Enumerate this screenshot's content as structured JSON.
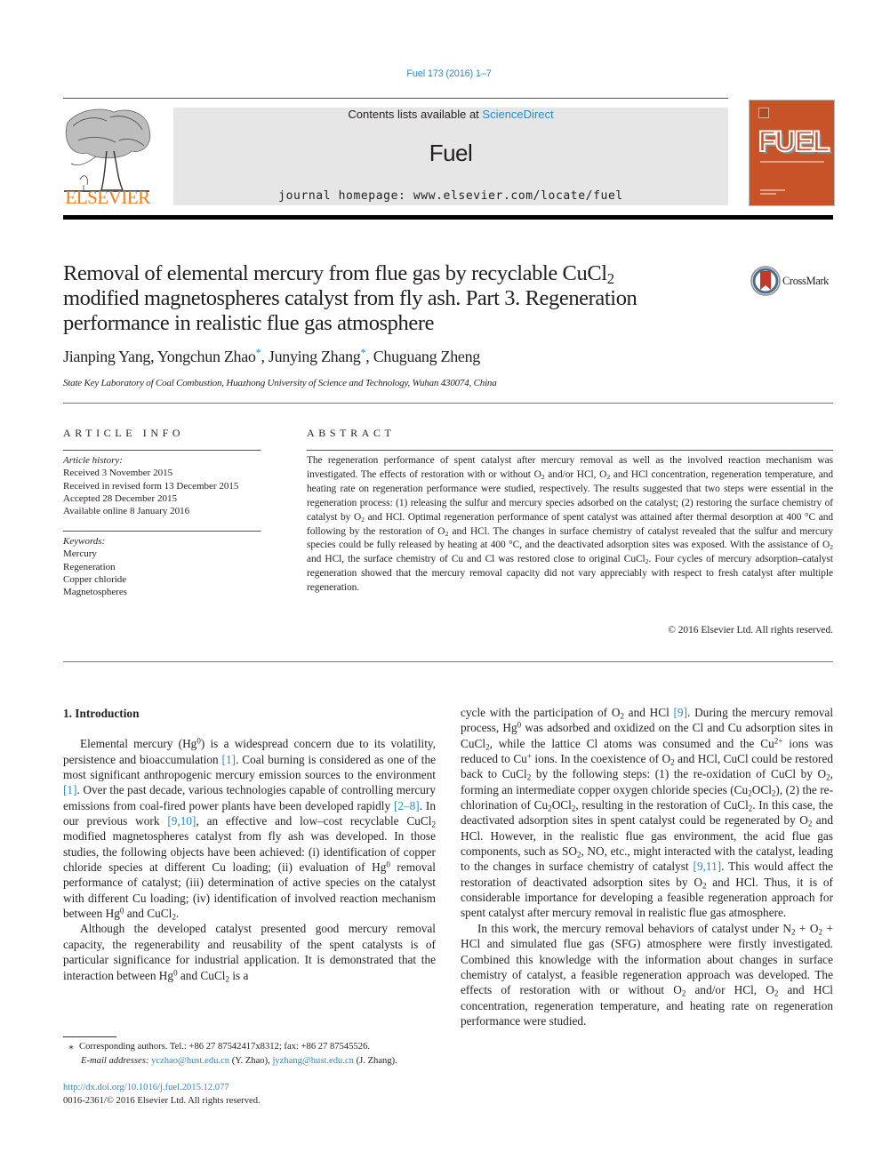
{
  "header": {
    "journal_ref": "Fuel 173 (2016) 1–7",
    "contents_prefix": "Contents lists available at ",
    "contents_link": "ScienceDirect",
    "journal_name": "Fuel",
    "homepage": "journal homepage: www.elsevier.com/locate/fuel",
    "publisher_logo_text": "ELSEVIER",
    "cover_title": "FUEL",
    "brand_colors": {
      "link": "#2a8cc2",
      "elsevier_orange": "#f07c1b",
      "cover": "#c95328",
      "masthead_bg": "#e6e6e6"
    }
  },
  "article": {
    "title_line1_pre": "Removal of elemental mercury from flue gas by recyclable CuCl",
    "title_line1_sub": "2",
    "title_rest": "modified magnetospheres catalyst from fly ash. Part 3. Regeneration performance in realistic flue gas atmosphere",
    "crossmark_label": "CrossMark",
    "authors": [
      {
        "name": "Jianping Yang",
        "corresponding": false
      },
      {
        "name": "Yongchun Zhao",
        "corresponding": true
      },
      {
        "name": "Junying Zhang",
        "corresponding": true
      },
      {
        "name": "Chuguang Zheng",
        "corresponding": false
      }
    ],
    "affiliation": "State Key Laboratory of Coal Combustion, Huazhong University of Science and Technology, Wuhan 430074, China"
  },
  "article_info": {
    "heading": "ARTICLE INFO",
    "history_label": "Article history:",
    "history": [
      "Received 3 November 2015",
      "Received in revised form 13 December 2015",
      "Accepted 28 December 2015",
      "Available online 8 January 2016"
    ],
    "keywords_label": "Keywords:",
    "keywords": [
      "Mercury",
      "Regeneration",
      "Copper chloride",
      "Magnetospheres"
    ]
  },
  "abstract": {
    "heading": "ABSTRACT",
    "text_html": "The regeneration performance of spent catalyst after mercury removal as well as the involved reaction mechanism was investigated. The effects of restoration with or without O<sub>2</sub> and/or HCl, O<sub>2</sub> and HCl concentration, regeneration temperature, and heating rate on regeneration performance were studied, respectively. The results suggested that two steps were essential in the regeneration process: (1) releasing the sulfur and mercury species adsorbed on the catalyst; (2) restoring the surface chemistry of catalyst by O<sub>2</sub> and HCl. Optimal regeneration performance of spent catalyst was attained after thermal desorption at 400 °C and following by the restoration of O<sub>2</sub> and HCl. The changes in surface chemistry of catalyst revealed that the sulfur and mercury species could be fully released by heating at 400 °C, and the deactivated adsorption sites was exposed. With the assistance of O<sub>2</sub> and HCl, the surface chemistry of Cu and Cl was restored close to original CuCl<sub>2</sub>. Four cycles of mercury adsorption–catalyst regeneration showed that the mercury removal capacity did not vary appreciably with respect to fresh catalyst after multiple regeneration.",
    "copyright": "© 2016 Elsevier Ltd. All rights reserved."
  },
  "body": {
    "section_heading": "1. Introduction",
    "left_paragraphs_html": [
      "Elemental mercury (Hg<sup>0</sup>) is a widespread concern due to its volatility, persistence and bioaccumulation <span class=\"link\">[1]</span>. Coal burning is considered as one of the most significant anthropogenic mercury emission sources to the environment <span class=\"link\">[1]</span>. Over the past decade, various technologies capable of controlling mercury emissions from coal-fired power plants have been developed rapidly <span class=\"link\">[2–8]</span>. In our previous work <span class=\"link\">[9,10]</span>, an effective and low–cost recyclable CuCl<sub>2</sub> modified magnetospheres catalyst from fly ash was developed. In those studies, the following objects have been achieved: (i) identification of copper chloride species at different Cu loading; (ii) evaluation of Hg<sup>0</sup> removal performance of catalyst; (iii) determination of active species on the catalyst with different Cu loading; (iv) identification of involved reaction mechanism between Hg<sup>0</sup> and CuCl<sub>2</sub>.",
      "Although the developed catalyst presented good mercury removal capacity, the regenerability and reusability of the spent catalysts is of particular significance for industrial application. It is demonstrated that the interaction between Hg<sup>0</sup> and CuCl<sub>2</sub> is a"
    ],
    "right_paragraphs_html": [
      "cycle with the participation of O<sub>2</sub> and HCl <span class=\"link\">[9]</span>. During the mercury removal process, Hg<sup>0</sup> was adsorbed and oxidized on the Cl and Cu adsorption sites in CuCl<sub>2</sub>, while the lattice Cl atoms was consumed and the Cu<sup>2+</sup> ions was reduced to Cu<sup>+</sup> ions. In the coexistence of O<sub>2</sub> and HCl, CuCl could be restored back to CuCl<sub>2</sub> by the following steps: (1) the re-oxidation of CuCl by O<sub>2</sub>, forming an intermediate copper oxygen chloride species (Cu<sub>2</sub>OCl<sub>2</sub>), (2) the re-chlorination of Cu<sub>2</sub>OCl<sub>2</sub>, resulting in the restoration of CuCl<sub>2</sub>. In this case, the deactivated adsorption sites in spent catalyst could be regenerated by O<sub>2</sub> and HCl. However, in the realistic flue gas environment, the acid flue gas components, such as SO<sub>2</sub>, NO, etc., might interacted with the catalyst, leading to the changes in surface chemistry of catalyst <span class=\"link\">[9,11]</span>. This would affect the restoration of deactivated adsorption sites by O<sub>2</sub> and HCl. Thus, it is of considerable importance for developing a feasible regeneration approach for spent catalyst after mercury removal in realistic flue gas atmosphere.",
      "In this work, the mercury removal behaviors of catalyst under N<sub>2</sub> + O<sub>2</sub> + HCl and simulated flue gas (SFG) atmosphere were firstly investigated. Combined this knowledge with the information about changes in surface chemistry of catalyst, a feasible regeneration approach was developed. The effects of restoration with or without O<sub>2</sub> and/or HCl, O<sub>2</sub> and HCl concentration, regeneration temperature, and heating rate on regeneration performance were studied."
    ]
  },
  "footnote": {
    "star": "⁎",
    "corresponding": "Corresponding authors. Tel.: +86 27 87542417x8312; fax: +86 27 87545526.",
    "email_label": "E-mail addresses:",
    "email1": "yczhao@hust.edu.cn",
    "email1_owner": " (Y. Zhao), ",
    "email2": "jyzhang@hust.edu.cn",
    "email2_owner": " (J. Zhang)."
  },
  "doi": {
    "link": "http://dx.doi.org/10.1016/j.fuel.2015.12.077",
    "issn_line": "0016-2361/© 2016 Elsevier Ltd. All rights reserved."
  }
}
